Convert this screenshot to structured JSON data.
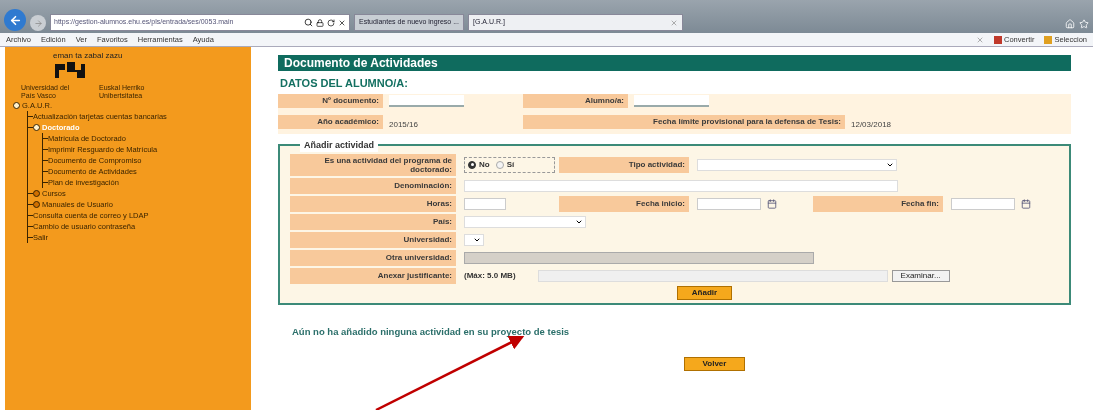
{
  "browser": {
    "address": "https://gestion-alumnos.ehu.es/pls/entrada/ses/0053.main",
    "tabs": [
      {
        "title": "Estudiantes de nuevo ingreso ...",
        "selected": false
      },
      {
        "title": "[G.A.U.R.]",
        "selected": true
      }
    ],
    "menu": [
      "Archivo",
      "Edición",
      "Ver",
      "Favoritos",
      "Herramientas",
      "Ayuda"
    ],
    "toolbar": [
      "Convertir",
      "Seleccion"
    ]
  },
  "sidebar": {
    "motto": "eman ta zabal zazu",
    "captions": [
      "Universidad del País Vasco",
      "Euskal Herriko Unibertsitatea"
    ],
    "tree": [
      {
        "label": "G.A.U.R.",
        "selected": false,
        "expanded": true,
        "children": [
          {
            "label": "Actualización tarjetas cuentas bancarias",
            "selected": false
          },
          {
            "label": "Doctorado",
            "selected": true,
            "expanded": true,
            "children": [
              {
                "label": "Matrícula de Doctorado",
                "selected": false
              },
              {
                "label": "Imprimir Resguardo de Matrícula",
                "selected": false
              },
              {
                "label": "Documento de Compromiso",
                "selected": false
              },
              {
                "label": "Documento de Actividades",
                "selected": false
              },
              {
                "label": "Plan de investigación",
                "selected": false
              }
            ]
          },
          {
            "label": "Cursos",
            "selected": false,
            "expanded": false
          },
          {
            "label": "Manuales de Usuario",
            "selected": false,
            "expanded": false
          },
          {
            "label": "Consulta cuenta de correo y LDAP",
            "selected": false
          },
          {
            "label": "Cambio de usuario contraseña",
            "selected": false
          },
          {
            "label": "Salir",
            "selected": false
          }
        ]
      }
    ]
  },
  "page": {
    "title": "Documento de Actividades",
    "section": "DATOS DEL ALUMNO/A:",
    "student_rows": [
      [
        {
          "kind": "label",
          "text": "Nº documento:"
        },
        {
          "kind": "redacted"
        },
        {
          "kind": "label",
          "text": "Alumno/a:"
        },
        {
          "kind": "redacted"
        }
      ],
      [
        {
          "kind": "label",
          "text": "Año académico:"
        },
        {
          "kind": "value",
          "text": "2015/16"
        },
        {
          "kind": "label_wide",
          "text": "Fecha límite provisional para la defensa de Tesis:"
        },
        {
          "kind": "value",
          "text": "12/03/2018"
        }
      ]
    ],
    "form": {
      "legend": "Añadir actividad",
      "rows": [
        [
          {
            "kind": "label",
            "text": "Es una actividad del programa de doctorado:"
          },
          {
            "kind": "radio",
            "options": [
              {
                "label": "No",
                "selected": true
              },
              {
                "label": "Sí",
                "selected": false
              }
            ]
          },
          {
            "kind": "label",
            "text": "Tipo actividad:"
          },
          {
            "kind": "select_wide"
          }
        ],
        [
          {
            "kind": "label",
            "text": "Denominación:"
          },
          {
            "kind": "input_wide"
          }
        ],
        [
          {
            "kind": "label",
            "text": "Horas:"
          },
          {
            "kind": "input_short"
          },
          {
            "kind": "label",
            "text": "Fecha inicio:"
          },
          {
            "kind": "date"
          },
          {
            "kind": "label",
            "text": "Fecha fin:"
          },
          {
            "kind": "date"
          }
        ],
        [
          {
            "kind": "label",
            "text": "País:"
          },
          {
            "kind": "select_medium"
          }
        ],
        [
          {
            "kind": "label",
            "text": "Universidad:"
          },
          {
            "kind": "select_small"
          }
        ],
        [
          {
            "kind": "label",
            "text": "Otra universidad:"
          },
          {
            "kind": "disabled_input"
          }
        ],
        [
          {
            "kind": "label",
            "text": "Anexar justificante:"
          },
          {
            "kind": "file",
            "note": "(Máx: 5.0 MB)",
            "button": "Examinar..."
          }
        ]
      ],
      "submit": "Añadir"
    },
    "message": "Aún no ha añadido ninguna actividad en su proyecto de tesis",
    "back": "Volver"
  }
}
